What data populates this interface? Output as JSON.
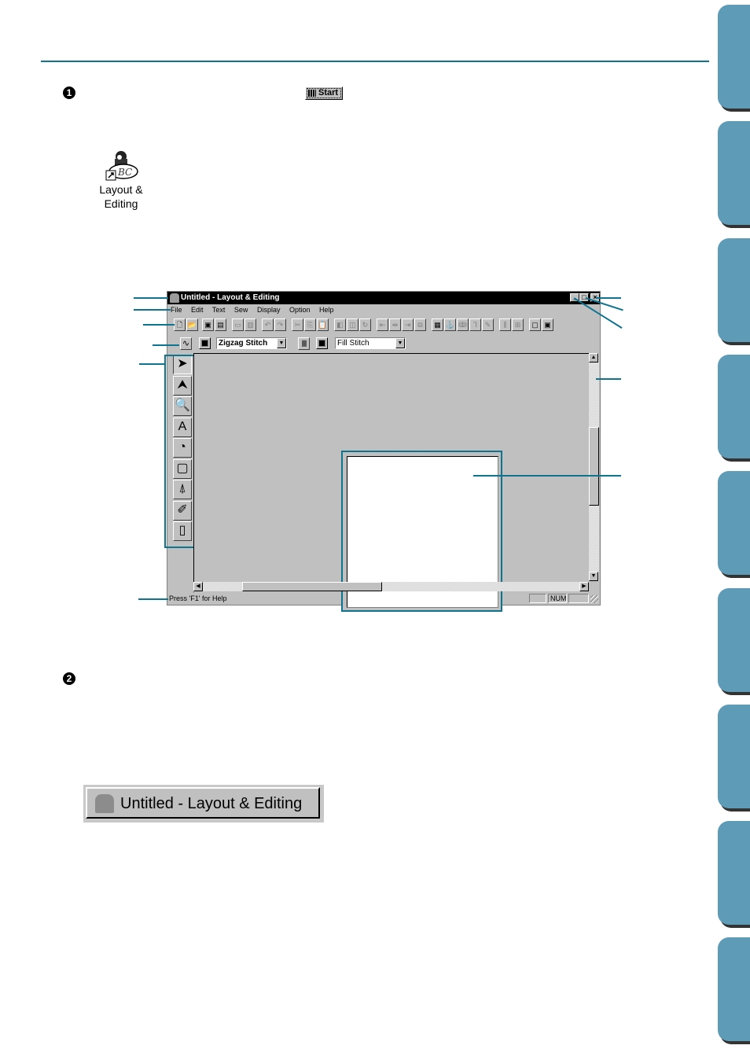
{
  "page": {
    "accent_color": "#0e7490",
    "tab_color": "#5e9bb7",
    "side_tab_count": 9
  },
  "steps": [
    {
      "number": "1",
      "inline_button": {
        "icon": "windows-flag-icon",
        "label": "Start"
      }
    },
    {
      "number": "2"
    }
  ],
  "desktop_icon": {
    "icon": "layout-editing-app-icon",
    "shortcut_icon": "shortcut-arrow-icon",
    "label_line1": "Layout &",
    "label_line2": "Editing"
  },
  "window": {
    "title": "Untitled - Layout & Editing",
    "caption_buttons": {
      "minimize": "_",
      "maximize": "□",
      "close": "×"
    },
    "menu": [
      "File",
      "Edit",
      "Text",
      "Sew",
      "Display",
      "Option",
      "Help"
    ],
    "toolbar_buttons": [
      {
        "name": "new-icon",
        "glyph": "🗋",
        "enabled": true
      },
      {
        "name": "open-icon",
        "glyph": "📂",
        "enabled": true
      },
      {
        "name": "import-icon",
        "glyph": "▣",
        "enabled": true
      },
      {
        "name": "browse-icon",
        "glyph": "▤",
        "enabled": true
      },
      {
        "name": "save-icon",
        "glyph": "▭",
        "enabled": false
      },
      {
        "name": "write-card-icon",
        "glyph": "▥",
        "enabled": false
      },
      {
        "name": "undo-icon",
        "glyph": "↶",
        "enabled": false
      },
      {
        "name": "redo-icon",
        "glyph": "↷",
        "enabled": false
      },
      {
        "name": "cut-icon",
        "glyph": "✂",
        "enabled": false
      },
      {
        "name": "copy-icon",
        "glyph": "⎘",
        "enabled": false
      },
      {
        "name": "paste-icon",
        "glyph": "📋",
        "enabled": false
      },
      {
        "name": "mirror-icon",
        "glyph": "◧",
        "enabled": false
      },
      {
        "name": "scale-icon",
        "glyph": "◫",
        "enabled": false
      },
      {
        "name": "rotate-icon",
        "glyph": "↻",
        "enabled": false
      },
      {
        "name": "align-left-icon",
        "glyph": "⇤",
        "enabled": false
      },
      {
        "name": "align-center-icon",
        "glyph": "⇹",
        "enabled": false
      },
      {
        "name": "align-right-icon",
        "glyph": "⇥",
        "enabled": false
      },
      {
        "name": "group-icon",
        "glyph": "⧉",
        "enabled": false
      },
      {
        "name": "design-page-icon",
        "glyph": "▦",
        "enabled": true
      },
      {
        "name": "sew-order-icon",
        "glyph": "⚓",
        "enabled": false
      },
      {
        "name": "text-path-icon",
        "glyph": "ↂ",
        "enabled": false
      },
      {
        "name": "text-attribute-icon",
        "glyph": "Ꞁ",
        "enabled": false
      },
      {
        "name": "text-edit-icon",
        "glyph": "✎",
        "enabled": false
      },
      {
        "name": "stitch-attribute-icon",
        "glyph": "⫼",
        "enabled": false
      },
      {
        "name": "sew-attribute-icon",
        "glyph": "⊞",
        "enabled": false
      },
      {
        "name": "preview-icon",
        "glyph": "▢",
        "enabled": true
      },
      {
        "name": "realistic-preview-icon",
        "glyph": "▣",
        "enabled": true
      }
    ],
    "sew_bar": {
      "line_sew_icon": "line-sew-icon",
      "line_color": "#000000",
      "line_stitch": "Zigzag Stitch",
      "region_sew_icon": "region-sew-icon",
      "region_color": "#000000",
      "region_stitch": "Fill Stitch"
    },
    "tools": [
      {
        "name": "select-tool-icon",
        "glyph": "➤",
        "selected": true
      },
      {
        "name": "point-edit-tool-icon",
        "glyph": "⮝",
        "selected": false
      },
      {
        "name": "zoom-tool-icon",
        "glyph": "🔍",
        "selected": false
      },
      {
        "name": "text-tool-icon",
        "glyph": "A",
        "selected": false
      },
      {
        "name": "shape-tool-icon",
        "glyph": "◔",
        "selected": false
      },
      {
        "name": "rectangle-tool-icon",
        "glyph": "▢",
        "selected": false
      },
      {
        "name": "stamp-tool-icon",
        "glyph": "⍋",
        "selected": false
      },
      {
        "name": "draw-tool-icon",
        "glyph": "✐",
        "selected": false
      },
      {
        "name": "manual-punch-tool-icon",
        "glyph": "▯",
        "selected": false
      }
    ],
    "status": {
      "help_text": "Press 'F1' for Help",
      "panes": [
        "",
        "NUM",
        ""
      ]
    }
  },
  "taskbar_button": {
    "icon": "layout-editing-app-icon",
    "label": "Untitled - Layout & Editing"
  }
}
